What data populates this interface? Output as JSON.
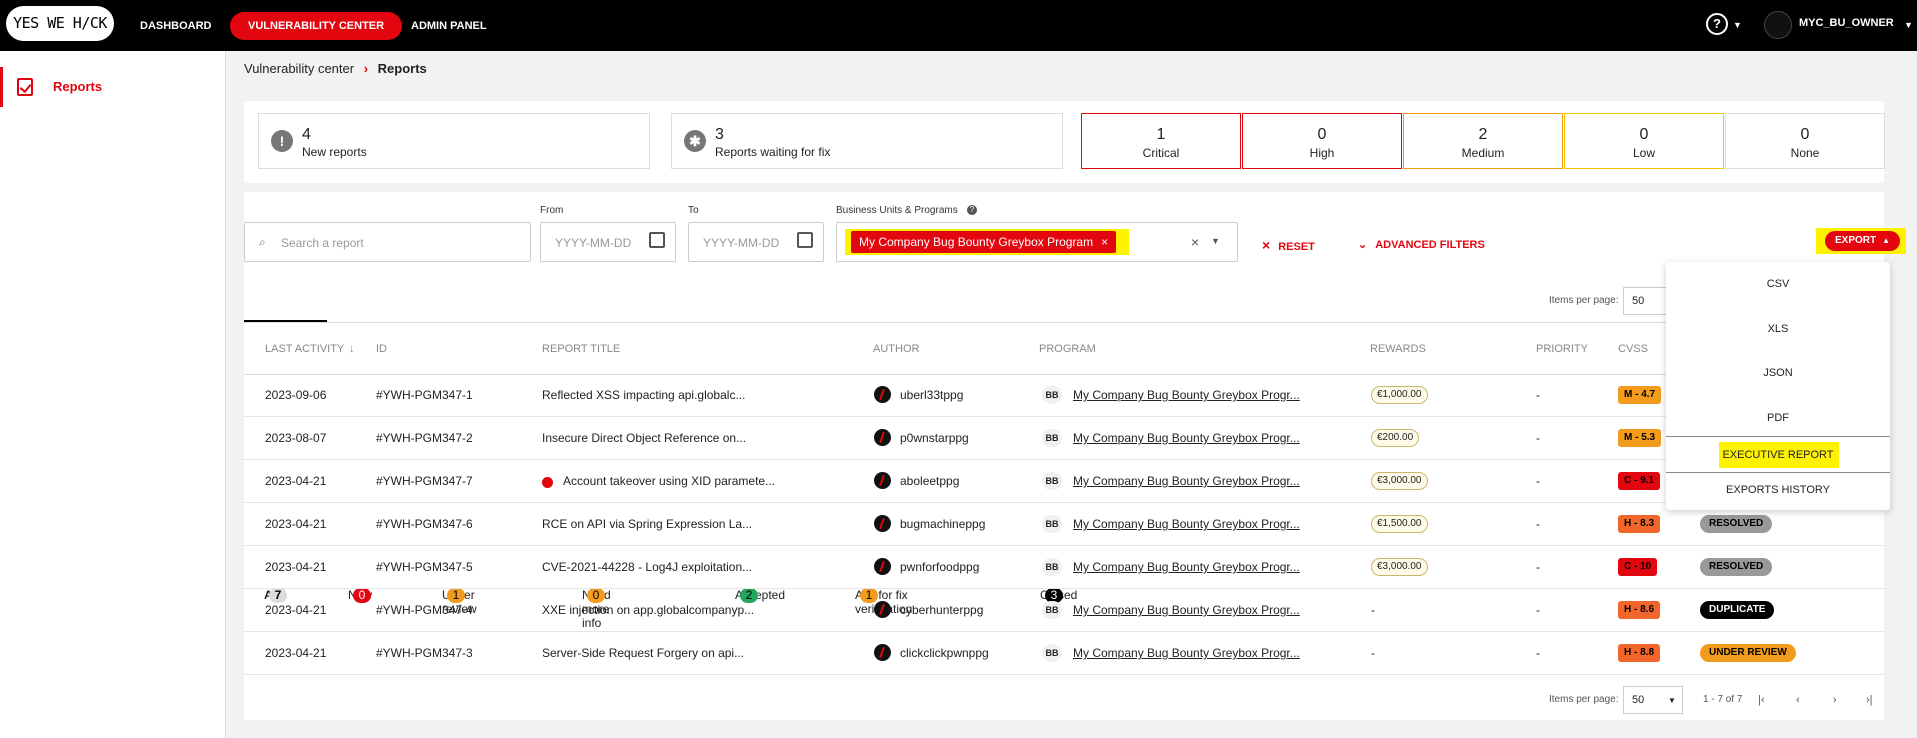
{
  "topbar": {
    "logo": "YES WE H/CK",
    "nav": [
      "DASHBOARD",
      "VULNERABILITY CENTER",
      "ADMIN PANEL"
    ],
    "help": "?",
    "user": "MYC_BU_OWNER"
  },
  "sidebar": {
    "reports": "Reports"
  },
  "breadcrumb": {
    "parent": "Vulnerability center",
    "sep": "›",
    "current": "Reports"
  },
  "stats": {
    "new_count": "4",
    "new_label": "New reports",
    "waiting_count": "3",
    "waiting_label": "Reports waiting for fix"
  },
  "severity": [
    {
      "num": "1",
      "label": "Critical",
      "color": "#e3060f"
    },
    {
      "num": "0",
      "label": "High",
      "color": "#e3060f"
    },
    {
      "num": "2",
      "label": "Medium",
      "color": "#f29b1d"
    },
    {
      "num": "0",
      "label": "Low",
      "color": "#f5c400"
    },
    {
      "num": "0",
      "label": "None",
      "color": "#dddddd"
    }
  ],
  "filters": {
    "search_placeholder": "Search a report",
    "from_label": "From",
    "from_placeholder": "YYYY-MM-DD",
    "to_label": "To",
    "to_placeholder": "YYYY-MM-DD",
    "bu_label": "Business Units & Programs",
    "bu_tag": "My Company Bug Bounty Greybox Program",
    "reset": "RESET",
    "advanced": "ADVANCED FILTERS",
    "export": "EXPORT"
  },
  "tabs": [
    {
      "label": "All",
      "count": "7"
    },
    {
      "label": "New",
      "count": "0"
    },
    {
      "label": "Under review",
      "count": "1"
    },
    {
      "label": "Need more info",
      "count": "0"
    },
    {
      "label": "Accepted",
      "count": "2"
    },
    {
      "label": "Ask for fix verification",
      "count": "1"
    },
    {
      "label": "Closed",
      "count": "3"
    }
  ],
  "items_per_page_label": "Items per page:",
  "items_per_page": "50",
  "table": {
    "headers": [
      "LAST ACTIVITY",
      "ID",
      "REPORT TITLE",
      "AUTHOR",
      "PROGRAM",
      "REWARDS",
      "PRIORITY",
      "CVSS"
    ],
    "rows": [
      {
        "date": "2023-09-06",
        "id": "#YWH-PGM347-1",
        "title": "Reflected XSS impacting api.globalc...",
        "author": "uberl33tppg",
        "bb": "BB",
        "program": "My Company Bug Bounty Greybox Progr...",
        "reward": "€1,000.00",
        "priority": "-",
        "cvss": "M - 4.7",
        "cvss_color": "#f29b1d",
        "status": "",
        "status_color": ""
      },
      {
        "date": "2023-08-07",
        "id": "#YWH-PGM347-2",
        "title": "Insecure Direct Object Reference on...",
        "author": "p0wnstarppg",
        "bb": "BB",
        "program": "My Company Bug Bounty Greybox Progr...",
        "reward": "€200.00",
        "priority": "-",
        "cvss": "M - 5.3",
        "cvss_color": "#f29b1d",
        "status": "",
        "status_color": ""
      },
      {
        "date": "2023-04-21",
        "id": "#YWH-PGM347-7",
        "title": "Account takeover using XID paramete...",
        "author": "aboleetppg",
        "bb": "BB",
        "program": "My Company Bug Bounty Greybox Progr...",
        "reward": "€3,000.00",
        "priority": "-",
        "cvss": "C - 9.1",
        "cvss_color": "#e3060f",
        "status": "",
        "status_color": ""
      },
      {
        "date": "2023-04-21",
        "id": "#YWH-PGM347-6",
        "title": "RCE on API via Spring Expression La...",
        "author": "bugmachineppg",
        "bb": "BB",
        "program": "My Company Bug Bounty Greybox Progr...",
        "reward": "€1,500.00",
        "priority": "-",
        "cvss": "H - 8.3",
        "cvss_color": "#f2662b",
        "status": "RESOLVED",
        "status_color": "#999999"
      },
      {
        "date": "2023-04-21",
        "id": "#YWH-PGM347-5",
        "title": "CVE-2021-44228 - Log4J exploitation...",
        "author": "pwnforfoodppg",
        "bb": "BB",
        "program": "My Company Bug Bounty Greybox Progr...",
        "reward": "€3,000.00",
        "priority": "-",
        "cvss": "C - 10",
        "cvss_color": "#e3060f",
        "status": "RESOLVED",
        "status_color": "#999999"
      },
      {
        "date": "2023-04-21",
        "id": "#YWH-PGM347-4",
        "title": "XXE injection on app.globalcompanyp...",
        "author": "cyberhunterppg",
        "bb": "BB",
        "program": "My Company Bug Bounty Greybox Progr...",
        "reward": "-",
        "priority": "-",
        "cvss": "H - 8.6",
        "cvss_color": "#f2662b",
        "status": "DUPLICATE",
        "status_color": "#000000"
      },
      {
        "date": "2023-04-21",
        "id": "#YWH-PGM347-3",
        "title": "Server-Side Request Forgery on api...",
        "author": "clickclickpwnppg",
        "bb": "BB",
        "program": "My Company Bug Bounty Greybox Progr...",
        "reward": "-",
        "priority": "-",
        "cvss": "H - 8.8",
        "cvss_color": "#f2662b",
        "status": "UNDER REVIEW",
        "status_color": "#f29b1d"
      }
    ]
  },
  "export_menu": [
    "CSV",
    "XLS",
    "JSON",
    "PDF",
    "EXECUTIVE REPORT",
    "EXPORTS HISTORY"
  ],
  "pager": {
    "range": "1 - 7 of 7"
  }
}
